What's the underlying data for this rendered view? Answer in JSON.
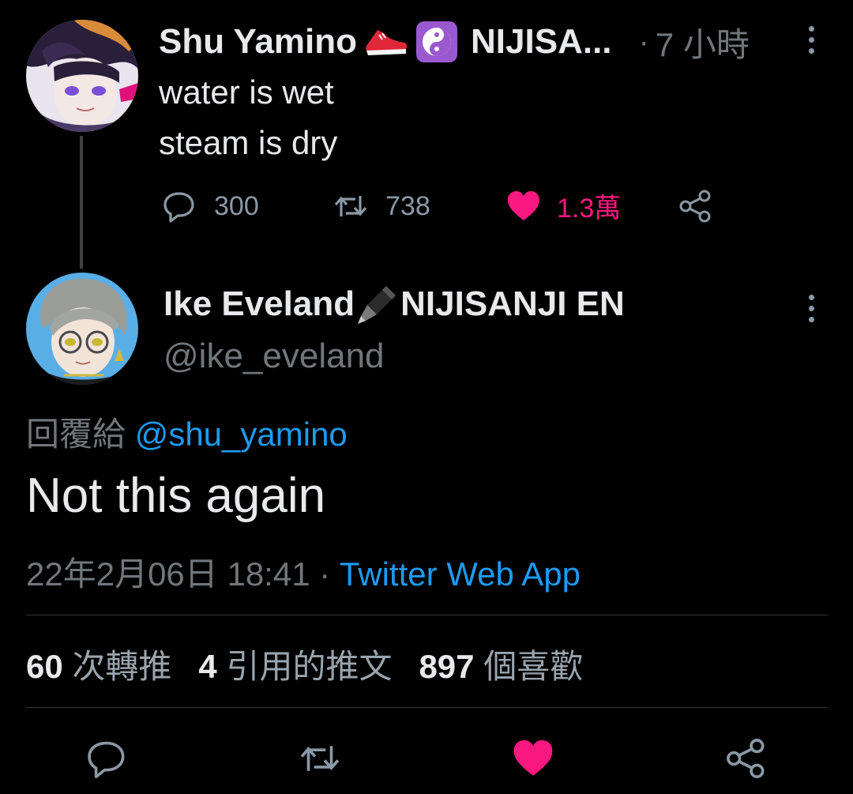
{
  "parent_tweet": {
    "author_name": "Shu Yamino",
    "author_org": "NIJISA...",
    "time": "7 小時",
    "line1": "water is wet",
    "line2": "steam is dry",
    "replies": "300",
    "retweets": "738",
    "likes": "1.3萬"
  },
  "main_tweet": {
    "author_name": "Ike Eveland",
    "author_org": "NIJISANJI EN",
    "handle": "@ike_eveland",
    "reply_prefix": "回覆給",
    "reply_to": "@shu_yamino",
    "text": "Not this again",
    "timestamp": "22年2月06日 18:41",
    "source": "Twitter Web App"
  },
  "stats": {
    "retweets_num": "60",
    "retweets_label": "次轉推",
    "quotes_num": "4",
    "quotes_label": "引用的推文",
    "likes_num": "897",
    "likes_label": "個喜歡"
  },
  "colors": {
    "like_active": "#f91880",
    "link": "#1d9bf0",
    "muted": "#71767b",
    "background": "#000000"
  }
}
